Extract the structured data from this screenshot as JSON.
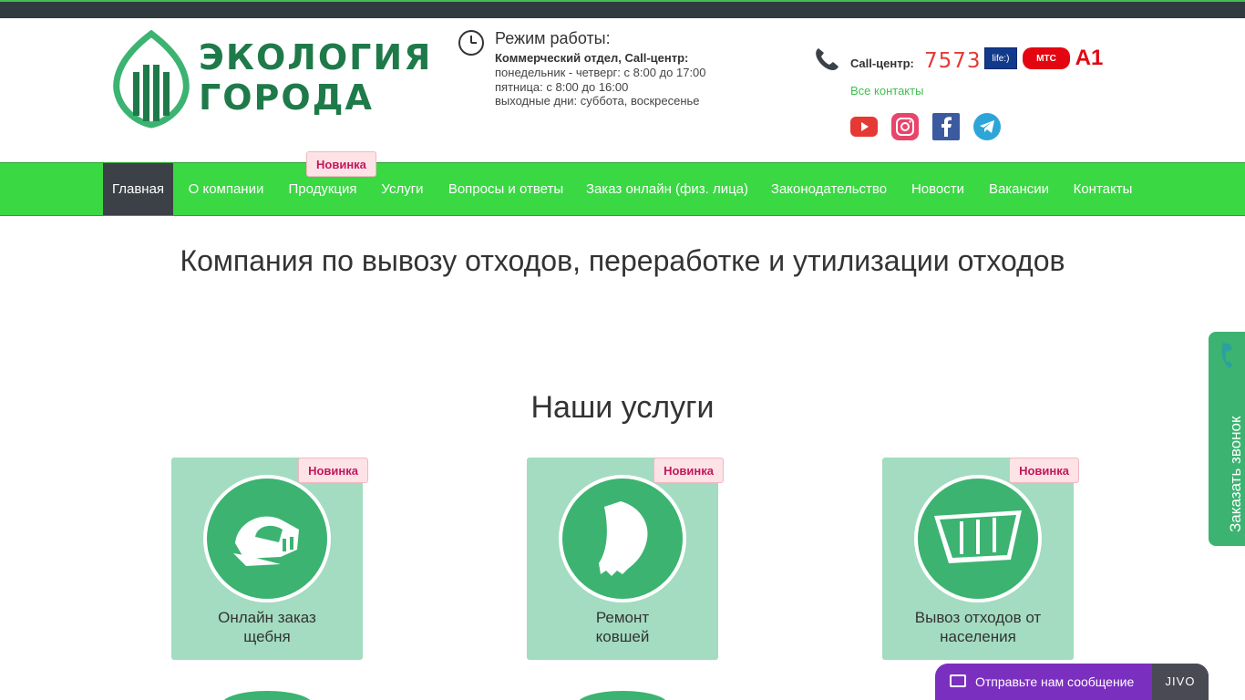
{
  "header": {
    "logo_line1": "ЭКОЛОГИЯ",
    "logo_line2": "ГОРОДА",
    "hours": {
      "title": "Режим работы:",
      "dept": "Коммерческий отдел, Call-центр:",
      "line1": "понедельник - четверг: с 8:00 до 17:00",
      "line2": "пятница: с 8:00 до 16:00",
      "line3": "выходные дни: суббота, воскресенье"
    },
    "call": {
      "label": "Call-центр:",
      "number": "7573",
      "operators": [
        "life:)",
        "МТС",
        "A1"
      ],
      "all_contacts": "Все контакты"
    }
  },
  "nav": {
    "items": [
      {
        "label": "Главная"
      },
      {
        "label": "О компании"
      },
      {
        "label": "Продукция"
      },
      {
        "label": "Услуги"
      },
      {
        "label": "Вопросы и ответы"
      },
      {
        "label": "Заказ онлайн (физ. лица)"
      },
      {
        "label": "Законодательство"
      },
      {
        "label": "Новости"
      },
      {
        "label": "Вакансии"
      },
      {
        "label": "Контакты"
      }
    ],
    "badge": "Новинка"
  },
  "main": {
    "intro": "Компания по вывозу отходов, переработке и утилизации отходов",
    "services_title": "Наши услуги",
    "cards": [
      {
        "label_line1": "Онлайн заказ",
        "label_line2": "щебня",
        "badge": "Новинка"
      },
      {
        "label_line1": "Ремонт",
        "label_line2": "ковшей",
        "badge": "Новинка"
      },
      {
        "label_line1": "Вывоз отходов от",
        "label_line2": "населения",
        "badge": "Новинка"
      }
    ]
  },
  "widgets": {
    "callback": "Заказать звонок",
    "jivo_message": "Отправьте нам сообщение",
    "jivo_brand": "JIVO"
  },
  "colors": {
    "nav_green": "#3ad843",
    "accent_green": "#3cb371",
    "card_bg": "#a3dcc0",
    "badge_text": "#c2185b",
    "call_number": "#e53935",
    "jivo_purple": "#7b2fbf"
  }
}
